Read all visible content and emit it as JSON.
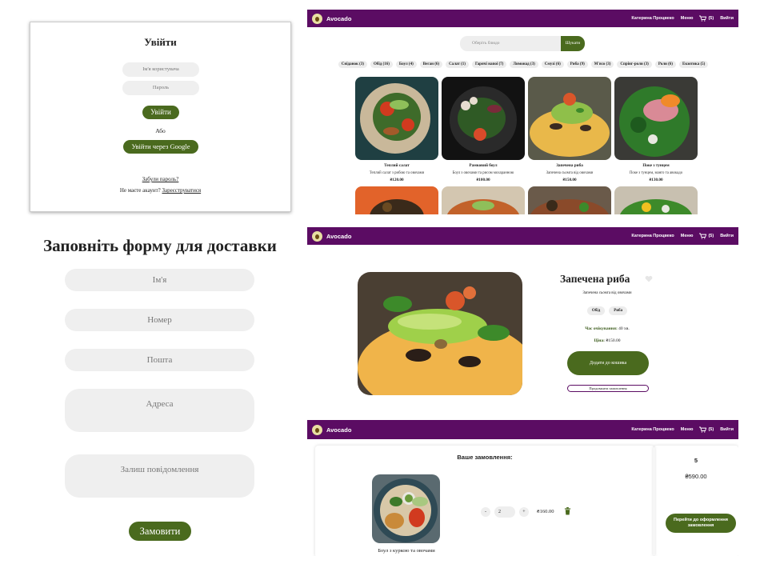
{
  "login": {
    "title": "Увійти",
    "username_placeholder": "Ім'я користувача",
    "password_placeholder": "Пароль",
    "login_button": "Увійти",
    "or_text": "Або",
    "google_button": "Увійти через Google",
    "forgot_link": "Забули пароль?",
    "no_account_text": "Не маєте акаунт?",
    "register_link": "Зареєструватися"
  },
  "delivery": {
    "title": "Заповніть форму для доставки",
    "name_placeholder": "Ім'я",
    "phone_placeholder": "Номер",
    "email_placeholder": "Пошта",
    "address_placeholder": "Адреса",
    "message_placeholder": "Залиш повідомлення",
    "order_button": "Замовити"
  },
  "navbar": {
    "brand": "Avocado",
    "user": "Катерина Процвеко",
    "menu": "Меню",
    "cart_count": "(5)",
    "logout": "Вийти"
  },
  "menu_page": {
    "search_placeholder": "Оберіть блюдо",
    "search_button": "Шукати",
    "categories": [
      "Сніданок (3)",
      "Обід (16)",
      "Боул (4)",
      "Веган (6)",
      "Салат (1)",
      "Гарячі напої (7)",
      "Лимонад (3)",
      "Смузі (6)",
      "Риба (9)",
      "М'ясо (3)",
      "Спрінг-роли (3)",
      "Роли (6)",
      "Екзотика (5)"
    ],
    "cards": [
      {
        "title": "Теплий салат",
        "desc": "Теплий салат з рибою та овочами",
        "price": "₴120.00"
      },
      {
        "title": "Рамковий боул",
        "desc": "Боул з овочами та рисом мохаранною",
        "price": "₴100.00"
      },
      {
        "title": "Запечена риба",
        "desc": "Запечена сьомга від овочами",
        "price": "₴150.00"
      },
      {
        "title": "Поке з тунцем",
        "desc": "Поке з тунцем, манго та авокадо",
        "price": "₴130.00"
      }
    ]
  },
  "product_page": {
    "title": "Запечена риба",
    "desc": "Запечена сьомга від овочами",
    "tags": [
      "Обід",
      "Риба"
    ],
    "wait_label": "Час очікування:",
    "wait_value": "40 хв.",
    "price_label": "Ціна:",
    "price_value": "₴150.00",
    "add_button": "Додати до кошика",
    "continue_button": "Продовжити замовлення"
  },
  "cart_page": {
    "title": "Ваше замовлення:",
    "item_name": "Боул з куркою та овочами",
    "quantity": "2",
    "minus": "-",
    "plus": "+",
    "item_price": "₴160.00",
    "total_count": "5",
    "total_price": "₴590.00",
    "checkout_button": "Перейти до оформлення замовлення"
  },
  "colors": {
    "brand_purple": "#5b0c63",
    "brand_green": "#4a6a1e"
  }
}
